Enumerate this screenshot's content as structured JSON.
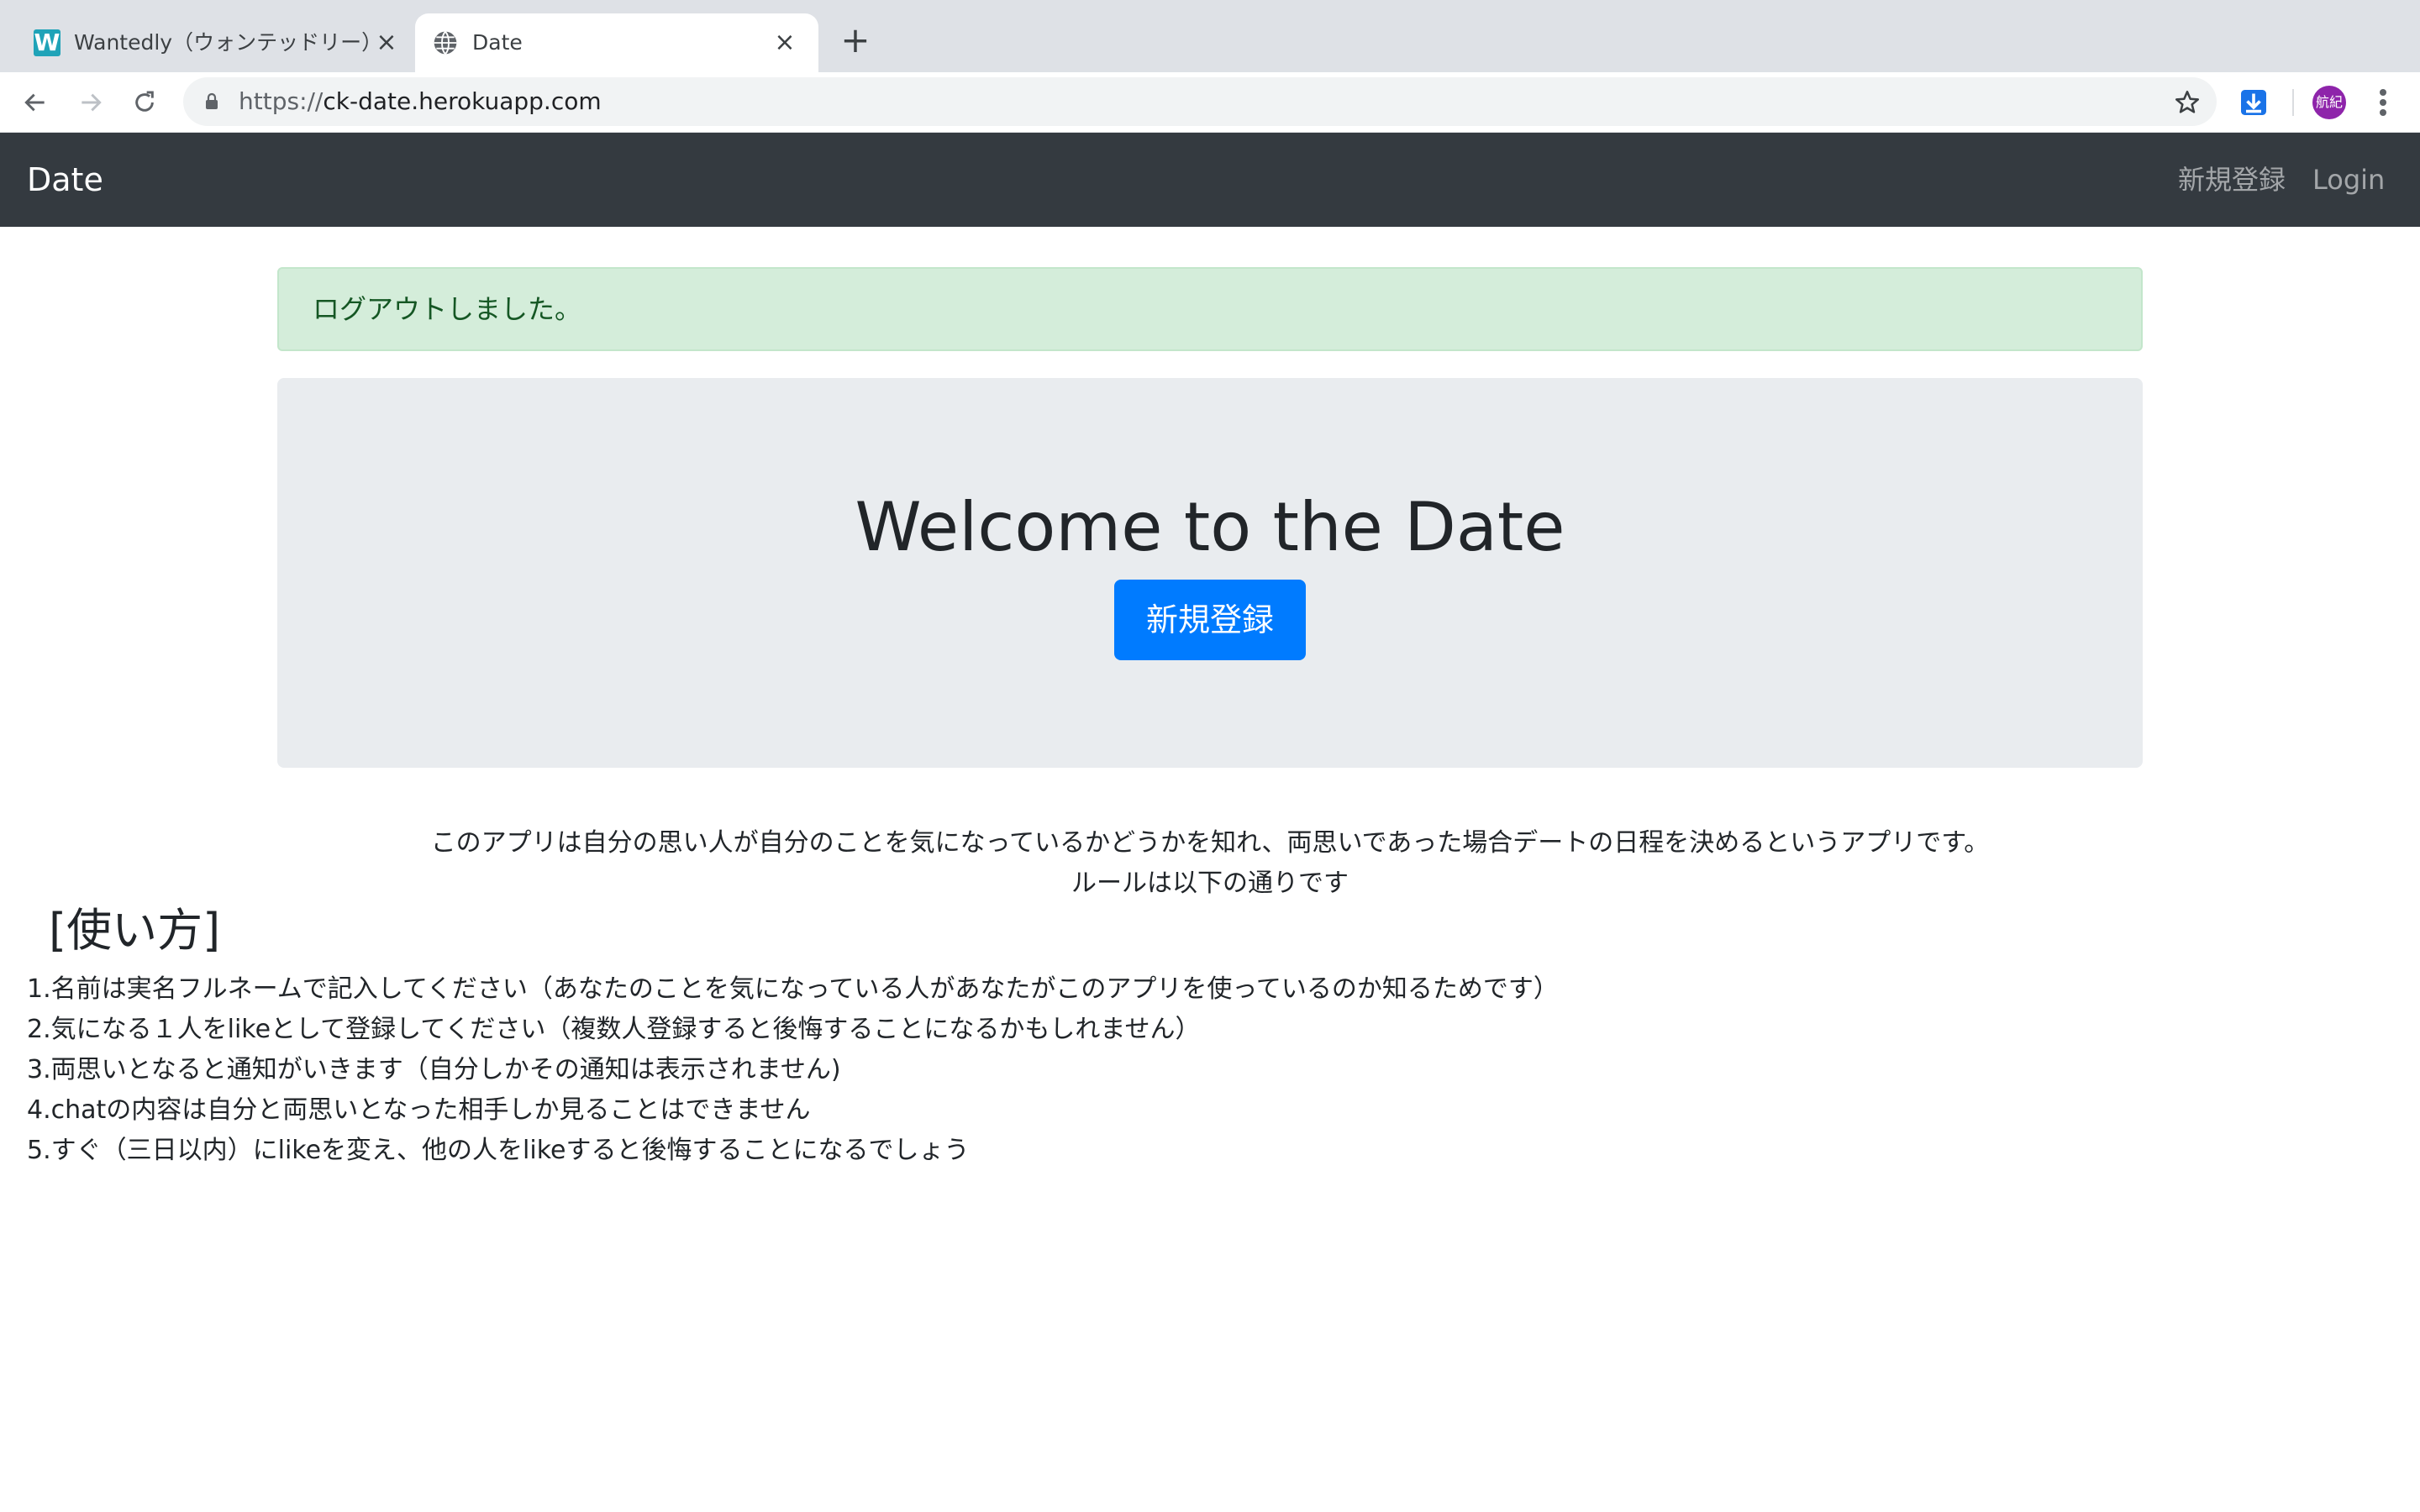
{
  "browser": {
    "tabs": [
      {
        "title": "Wantedly（ウォンテッドリー）は",
        "favicon": "wantedly-favicon",
        "favicon_letter": "W",
        "active": false
      },
      {
        "title": "Date",
        "favicon": "globe-icon",
        "active": true
      }
    ],
    "address_bar": {
      "scheme": "https://",
      "host": "ck-date.herokuapp.com"
    },
    "profile_initials": "航紀"
  },
  "navbar": {
    "brand": "Date",
    "links": [
      "新規登録",
      "Login"
    ]
  },
  "alert": {
    "message": "ログアウトしました。",
    "color": "#d4edda"
  },
  "hero": {
    "title": "Welcome to the Date",
    "button": "新規登録",
    "button_color": "#007bff"
  },
  "intro": {
    "line1": "このアプリは自分の思い人が自分のことを気になっているかどうかを知れ、両思いであった場合デートの日程を決めるというアプリです。",
    "line2": "ルールは以下の通りです"
  },
  "howto": {
    "heading": "[使い方]",
    "rules": [
      "1.名前は実名フルネームで記入してください（あなたのことを気になっている人があなたがこのアプリを使っているのか知るためです）",
      "2.気になる１人をlikeとして登録してください（複数人登録すると後悔することになるかもしれません）",
      "3.両思いとなると通知がいきます（自分しかその通知は表示されません)",
      "4.chatの内容は自分と両思いとなった相手しか見ることはできません",
      "5.すぐ（三日以内）にlikeを変え、他の人をlikeすると後悔することになるでしょう"
    ]
  }
}
